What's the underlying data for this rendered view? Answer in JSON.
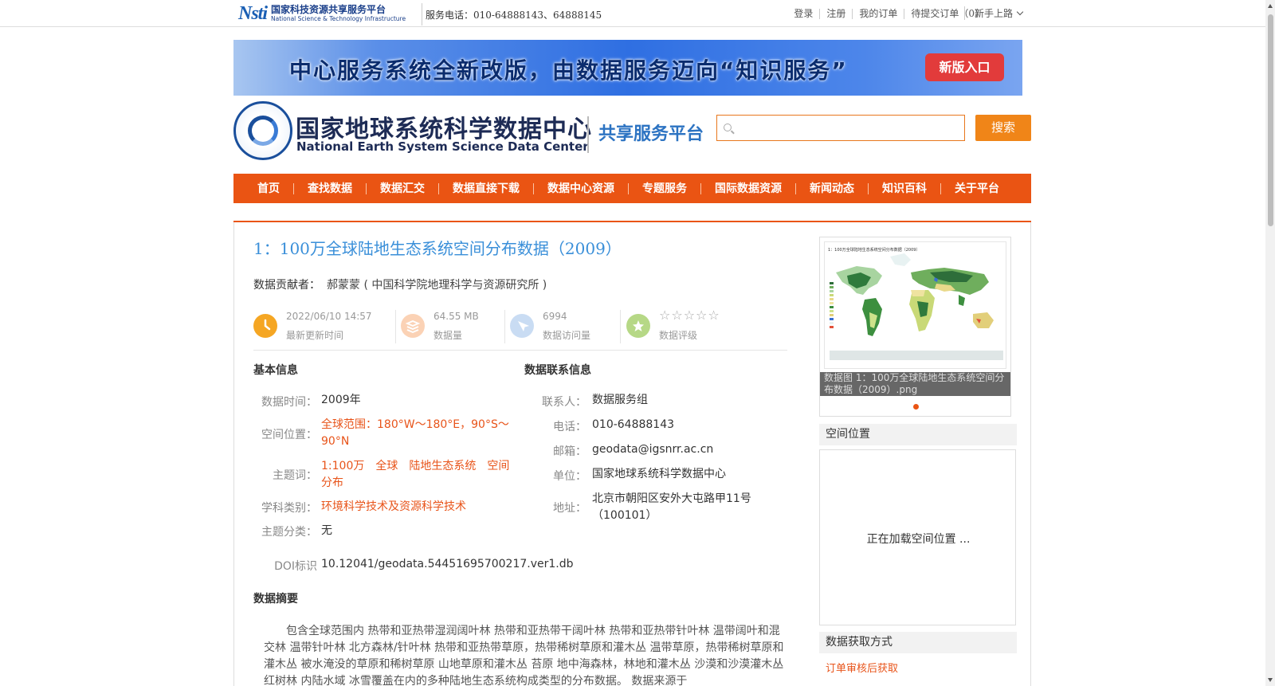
{
  "topbar": {
    "logo_mark": "Nsti",
    "logo_cn": "国家科技资源共享服务平台",
    "logo_en": "National Science & Technology Infrastructure",
    "service_phone": "服务电话：010-64888143、64888145",
    "links": [
      "登录",
      "注册",
      "我的订单",
      "待提交订单（0）"
    ],
    "guide_label": "新手上路"
  },
  "banner": {
    "text": "中心服务系统全新改版，由数据服务迈向“知识服务”",
    "button_label": "新版入口"
  },
  "header": {
    "center_name_cn": "国家地球系统科学数据中心",
    "center_name_en": "National Earth System Science Data Center",
    "platform_name": "共享服务平台",
    "search_placeholder": "",
    "search_button": "搜索"
  },
  "nav": {
    "items": [
      "首页",
      "查找数据",
      "数据汇交",
      "数据直接下载",
      "数据中心资源",
      "专题服务",
      "国际数据资源",
      "新闻动态",
      "知识百科",
      "关于平台"
    ]
  },
  "dataset": {
    "title": "1：100万全球陆地生态系统空间分布数据（2009）",
    "contributor_label": "数据贡献者：",
    "contributor": "郝蒙蒙 ( 中国科学院地理科学与资源研究所 )",
    "stats": {
      "updated_value": "2022/06/10 14:57",
      "updated_label": "最新更新时间",
      "size_value": "64.55 MB",
      "size_label": "数据量",
      "visits_value": "6994",
      "visits_label": "数据访问量",
      "rating_stars": "☆☆☆☆☆",
      "rating_label": "数据评级",
      "rating": 0
    },
    "basic_info": {
      "heading": "基本信息",
      "time_label": "数据时间：",
      "time_value": "2009年",
      "space_label": "空间位置：",
      "space_value": "全球范围：180°W～180°E，90°S～90°N",
      "keywords_label": "主题词：",
      "keywords_value": "1:100万　全球　陆地生态系统　空间分布",
      "discipline_label": "学科类别：",
      "discipline_value": "环境科学技术及资源科学技术",
      "category_label": "主题分类：",
      "category_value": "无",
      "doi_label": "DOI标识",
      "doi_value": "10.12041/geodata.54451695700217.ver1.db"
    },
    "contact_info": {
      "heading": "数据联系信息",
      "person_label": "联系人：",
      "person_value": "数据服务组",
      "phone_label": "电话：",
      "phone_value": "010-64888143",
      "email_label": "邮箱：",
      "email_value": "geodata@igsnrr.ac.cn",
      "org_label": "单位：",
      "org_value": "国家地球系统科学数据中心",
      "addr_label": "地址：",
      "addr_value": "北京市朝阳区安外大屯路甲11号（100101）"
    },
    "abstract": {
      "heading": "数据摘要",
      "text": "包含全球范围内 热带和亚热带湿润阔叶林 热带和亚热带干阔叶林 热带和亚热带针叶林 温带阔叶和混交林 温带针叶林 北方森林/针叶林 热带和亚热带草原，热带稀树草原和灌木丛 温带草原，热带稀树草原和灌木丛 被水淹没的草原和稀树草原 山地草原和灌木丛 苔原 地中海森林，林地和灌木丛 沙漠和沙漠灌木丛 红树林 内陆水域 冰雪覆盖在内的多种陆地生态系统构成类型的分布数据。 数据来源于"
    }
  },
  "sidebar": {
    "thumbnail_map_title": "1：100万全球陆地生态系统空间分布数据（2009）",
    "thumbnail_caption": "数据图 1：100万全球陆地生态系统空间分布数据（2009）.png",
    "spatial_heading": "空间位置",
    "spatial_loading": "正在加载空间位置 ...",
    "acquire_heading": "数据获取方式",
    "acquire_link": "订单审核后获取"
  },
  "colors": {
    "nav_bg": "#ea5413",
    "title_blue": "#3a8fd9",
    "accent_orange": "#e8541a",
    "search_button": "#f08518",
    "banner_button": "#e23b3b"
  }
}
